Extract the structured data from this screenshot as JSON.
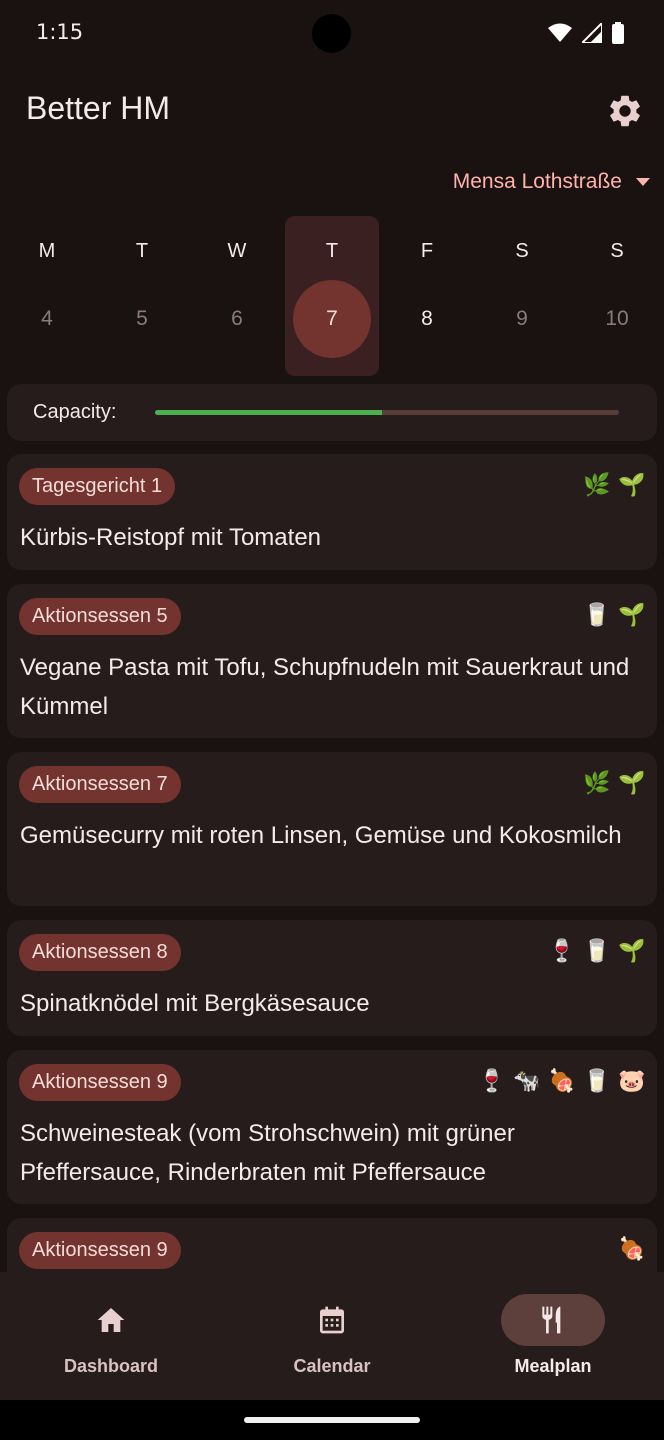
{
  "status_bar": {
    "time": "1:15"
  },
  "app": {
    "title": "Better HM"
  },
  "mensa": {
    "selected": "Mensa Lothstraße"
  },
  "week": [
    {
      "letter": "M",
      "number": "4"
    },
    {
      "letter": "T",
      "number": "5"
    },
    {
      "letter": "W",
      "number": "6"
    },
    {
      "letter": "T",
      "number": "7",
      "selected": true
    },
    {
      "letter": "F",
      "number": "8"
    },
    {
      "letter": "S",
      "number": "9"
    },
    {
      "letter": "S",
      "number": "10"
    }
  ],
  "capacity": {
    "label": "Capacity:",
    "fraction": 0.49,
    "fill_color": "#4caf50"
  },
  "meals": [
    {
      "tag": "Tagesgericht 1",
      "name": "Kürbis-Reistopf mit Tomaten",
      "icons": [
        "🌿",
        "🌱"
      ]
    },
    {
      "tag": "Aktionsessen 5",
      "name": "Vegane Pasta mit Tofu, Schupfnudeln mit Sauerkraut und Kümmel",
      "icons": [
        "🥛",
        "🌱"
      ]
    },
    {
      "tag": "Aktionsessen 7",
      "name": "Gemüsecurry mit roten Linsen, Gemüse und Kokosmilch",
      "icons": [
        "🌿",
        "🌱"
      ]
    },
    {
      "tag": "Aktionsessen 8",
      "name": "Spinatknödel mit Bergkäsesauce",
      "icons": [
        "🍷",
        "🥛",
        "🌱"
      ]
    },
    {
      "tag": "Aktionsessen 9",
      "name": "Schweinesteak (vom Strohschwein) mit grüner Pfeffersauce, Rinderbraten mit Pfeffersauce",
      "icons": [
        "🍷",
        "🐄",
        "🍖",
        "🥛",
        "🐷"
      ]
    },
    {
      "tag": "Aktionsessen 9",
      "name": "",
      "icons": [
        "🍖"
      ]
    }
  ],
  "nav": {
    "dashboard": "Dashboard",
    "calendar": "Calendar",
    "mealplan": "Mealplan",
    "active": "mealplan"
  },
  "colors": {
    "accent": "#ffb3ac",
    "tag_bg": "#73332f",
    "background": "#1a1111",
    "card": "#261c1c"
  }
}
